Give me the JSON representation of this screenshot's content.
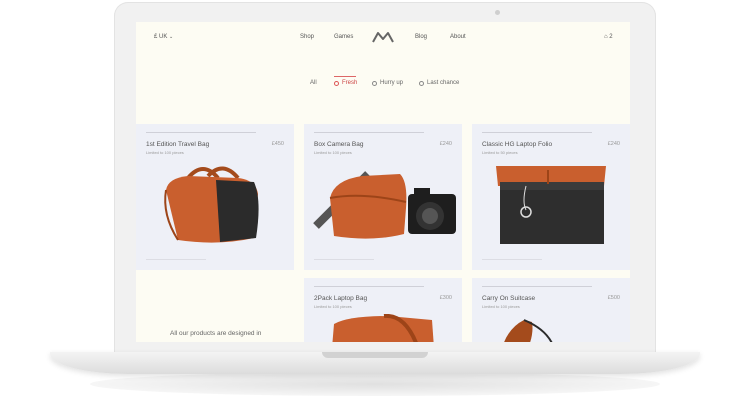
{
  "nav": {
    "currency": "£ UK",
    "items": [
      "Shop",
      "Games",
      "Blog",
      "About"
    ],
    "cart_count": "2"
  },
  "filters": [
    "All",
    "Fresh",
    "Hurry up",
    "Last chance"
  ],
  "products": [
    {
      "title": "1st Edition Travel Bag",
      "subtitle": "Limited to 100 pieces",
      "price": "£450"
    },
    {
      "title": "Box Camera Bag",
      "subtitle": "Limited to 100 pieces",
      "price": "£240"
    },
    {
      "title": "Classic HG Laptop Folio",
      "subtitle": "Limited to 50 pieces",
      "price": "£240"
    },
    {
      "title": "2Pack Laptop Bag",
      "subtitle": "Limited to 100 pieces",
      "price": "£300"
    },
    {
      "title": "Carry On Suitcase",
      "subtitle": "Limited to 100 pieces",
      "price": "£500"
    }
  ],
  "about_text": "All our products are designed in",
  "colors": {
    "accent": "#c95f2e",
    "card_bg": "#eef0f7",
    "screen_bg": "#fdfcf3",
    "fresh": "#d55555"
  }
}
